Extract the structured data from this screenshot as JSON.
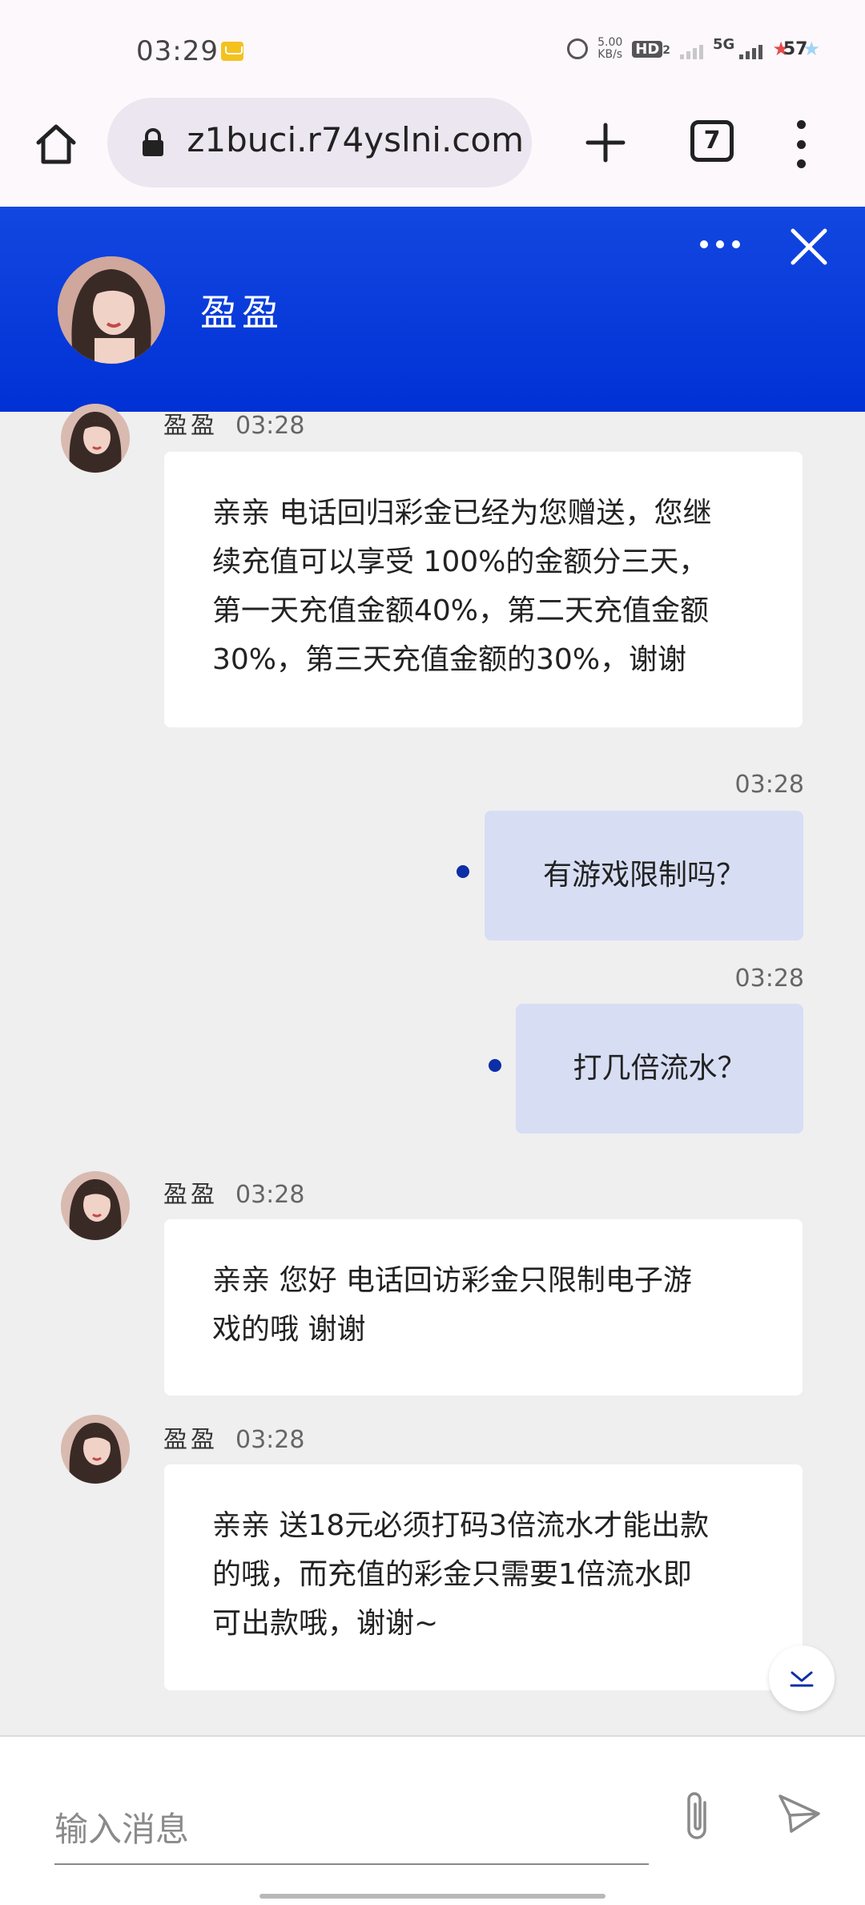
{
  "status_bar": {
    "time": "03:29",
    "net_speed_value": "5.00",
    "net_speed_unit": "KB/s",
    "hd_label": "HD",
    "hd_sub": "2",
    "network": "5G",
    "battery": "57"
  },
  "browser": {
    "url": "z1buci.r74yslni.com",
    "tab_count": "7"
  },
  "chat_header": {
    "agent_name": "盈盈"
  },
  "messages": [
    {
      "direction": "in",
      "sender": "盈盈",
      "time": "03:28",
      "lines": [
        "亲亲 电话回归彩金已经为您赠送，您继",
        "续充值可以享受 100%的金额分三天，",
        "第一天充值金额40%，第二天充值金额",
        "30%，第三天充值金额的30%，谢谢"
      ]
    },
    {
      "direction": "out",
      "time": "03:28",
      "text": "有游戏限制吗？"
    },
    {
      "direction": "out",
      "time": "03:28",
      "text": "打几倍流水？"
    },
    {
      "direction": "in",
      "sender": "盈盈",
      "time": "03:28",
      "lines": [
        "亲亲 您好 电话回访彩金只限制电子游",
        "戏的哦 谢谢"
      ]
    },
    {
      "direction": "in",
      "sender": "盈盈",
      "time": "03:28",
      "lines": [
        "亲亲 送18元必须打码3倍流水才能出款",
        "的哦，而充值的彩金只需要1倍流水即",
        "可出款哦，谢谢~"
      ]
    }
  ],
  "input": {
    "placeholder": "输入消息"
  },
  "colors": {
    "header_blue": "#0031d6",
    "outgoing_bubble": "#d7def4",
    "incoming_bubble": "#ffffff",
    "chat_background": "#efeff0"
  }
}
